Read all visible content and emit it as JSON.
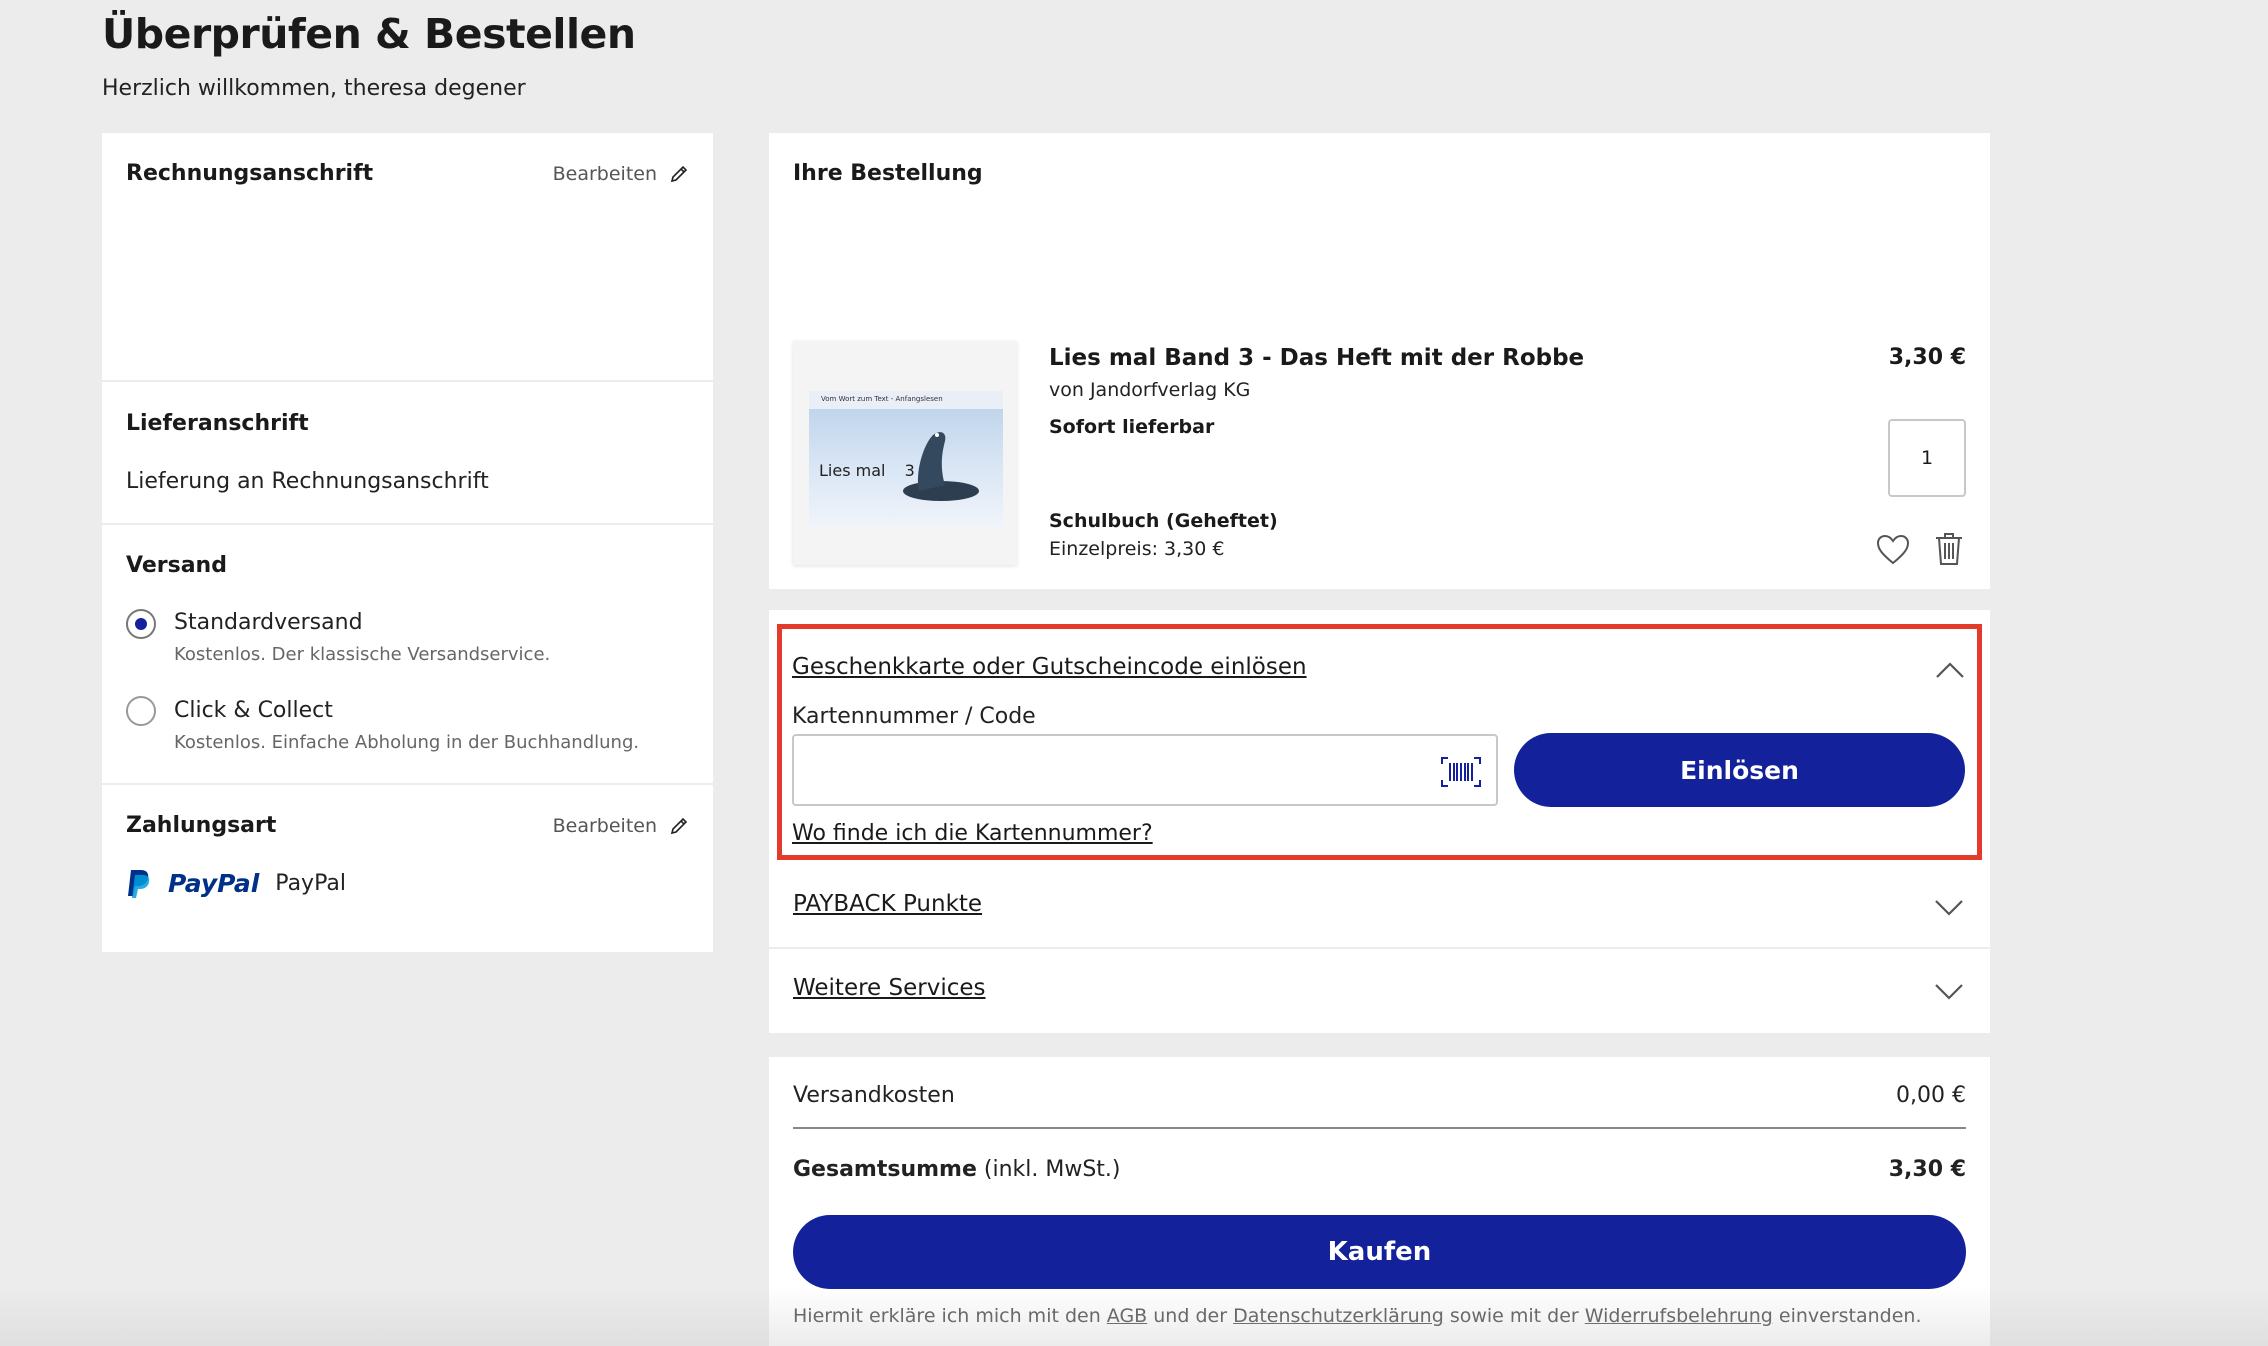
{
  "page": {
    "title": "Überprüfen & Bestellen",
    "welcome": "Herzlich willkommen, theresa degener"
  },
  "billing": {
    "title": "Rechnungsanschrift",
    "edit_label": "Bearbeiten"
  },
  "delivery": {
    "title": "Lieferanschrift",
    "value": "Lieferung an Rechnungsanschrift"
  },
  "shipping": {
    "title": "Versand",
    "options": [
      {
        "label": "Standardversand",
        "description": "Kostenlos. Der klassische Versandservice.",
        "selected": true
      },
      {
        "label": "Click & Collect",
        "description": "Kostenlos. Einfache Abholung in der Buchhandlung.",
        "selected": false
      }
    ]
  },
  "payment": {
    "title": "Zahlungsart",
    "edit_label": "Bearbeiten",
    "logo_text": "PayPal",
    "method": "PayPal"
  },
  "order": {
    "title": "Ihre Bestellung",
    "item": {
      "name": "Lies mal Band 3 - Das Heft mit der Robbe",
      "publisher": "von Jandorfverlag KG",
      "availability": "Sofort lieferbar",
      "type": "Schulbuch (Geheftet)",
      "unit_price": "Einzelpreis: 3,30 €",
      "price": "3,30 €",
      "quantity": "1",
      "cover": {
        "top_text": "Vom Wort zum Text - Anfangslesen",
        "title": "Lies mal",
        "number": "3"
      }
    }
  },
  "coupon": {
    "toggle_label": "Geschenkkarte oder Gutscheincode einlösen",
    "field_label": "Kartennummer / Code",
    "input_value": "",
    "button_label": "Einlösen",
    "help_link": "Wo finde ich die Kartennummer?"
  },
  "services": [
    {
      "label": "PAYBACK Punkte"
    },
    {
      "label": "Weitere Services"
    }
  ],
  "totals": {
    "shipping_label": "Versandkosten",
    "shipping_value": "0,00 €",
    "total_label": "Gesamtsumme",
    "total_suffix": "(inkl. MwSt.)",
    "total_value": "3,30 €",
    "buy_label": "Kaufen",
    "legal": {
      "part1": "Hiermit erkläre ich mich mit den",
      "agb": "AGB",
      "part2": "und der",
      "privacy": "Datenschutzerklärung",
      "part3": "sowie mit der",
      "withdrawal": "Widerrufsbelehrung",
      "part4": "einverstanden."
    }
  },
  "colors": {
    "primary": "#13229a",
    "highlight": "#e23a2b",
    "background": "#ececec"
  }
}
